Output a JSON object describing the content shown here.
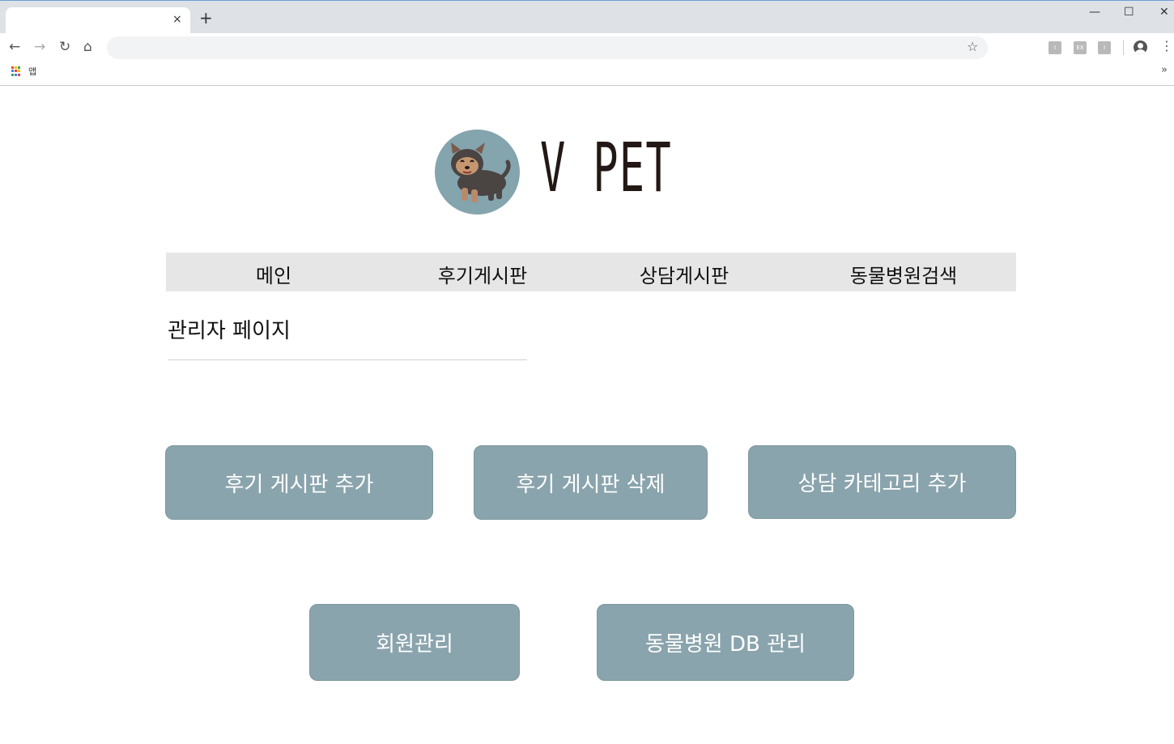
{
  "browser": {
    "tab_title": "",
    "tab_close": "×",
    "new_tab": "+",
    "window_controls": {
      "minimize": "—",
      "maximize": "☐",
      "close": "✕"
    },
    "nav": {
      "back": "←",
      "forward": "→",
      "reload": "↻",
      "home": "⌂"
    },
    "address_value": "",
    "bookmark_star": "☆",
    "extensions": [
      "I",
      "EX",
      "I"
    ],
    "menu": "⋮",
    "bookmarks_bar": {
      "apps_label": "앱",
      "more": "»"
    },
    "apps_colors": [
      "#ea4335",
      "#fbbc05",
      "#34a853",
      "#4285f4",
      "#ea4335",
      "#fbbc05",
      "#34a853",
      "#4285f4",
      "#ea4335"
    ]
  },
  "logo": {
    "text": "V PET",
    "icon": "puppy-logo-icon"
  },
  "nav": {
    "items": [
      {
        "label": "메인"
      },
      {
        "label": "후기게시판"
      },
      {
        "label": "상담게시판"
      },
      {
        "label": "동물병원검색"
      }
    ]
  },
  "page": {
    "heading": "관리자 페이지"
  },
  "admin_buttons": {
    "review_add": "후기 게시판 추가",
    "review_delete": "후기 게시판 삭제",
    "consult_category_add": "상담 카테고리 추가",
    "member_manage": "회원관리",
    "hospital_db_manage": "동물병원 DB 관리"
  },
  "colors": {
    "button": "#8aa4ad",
    "nav_bg": "#e6e6e6",
    "logo_circle": "#84a4ae"
  }
}
